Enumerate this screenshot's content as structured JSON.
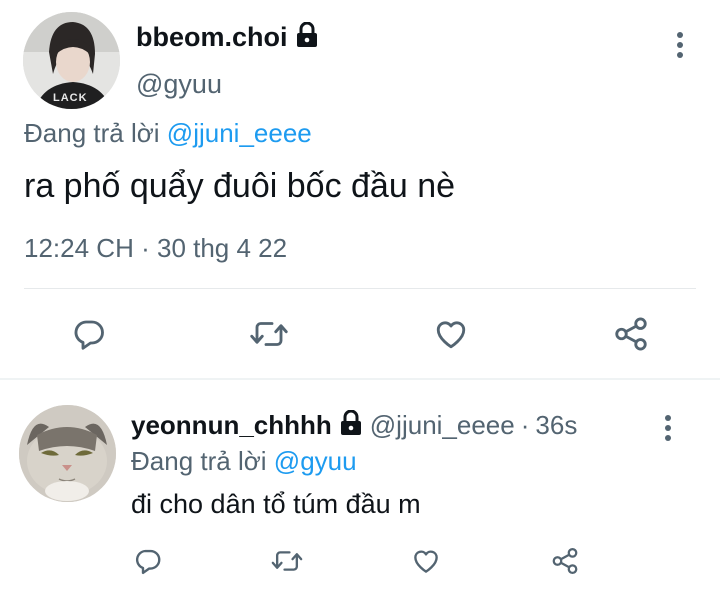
{
  "main_tweet": {
    "display_name": "bbeom.choi",
    "handle": "@gyuu",
    "reply_prefix": "Đang trả lời",
    "reply_to": "@jjuni_eeee",
    "text": "ra phố quẩy đuôi bốc đầu nè",
    "time": "12:24 CH",
    "separator": "·",
    "date": "30 thg 4 22",
    "avatar_shirt_text": "LACK"
  },
  "reply_tweet": {
    "display_name": "yeonnun_chhhh",
    "handle": "@jjuni_eeee",
    "separator": "·",
    "age": "36s",
    "reply_prefix": "Đang trả lời",
    "reply_to": "@gyuu",
    "text": "đi cho dân tổ túm đầu m"
  },
  "icons": {
    "reply": "reply-icon",
    "retweet": "retweet-icon",
    "like": "like-icon",
    "share": "share-icon",
    "lock": "lock-icon",
    "more": "more-vertical-icon"
  },
  "colors": {
    "text": "#0f1419",
    "muted": "#536471",
    "link": "#1d9bf0",
    "divider": "#e6e9eb"
  }
}
